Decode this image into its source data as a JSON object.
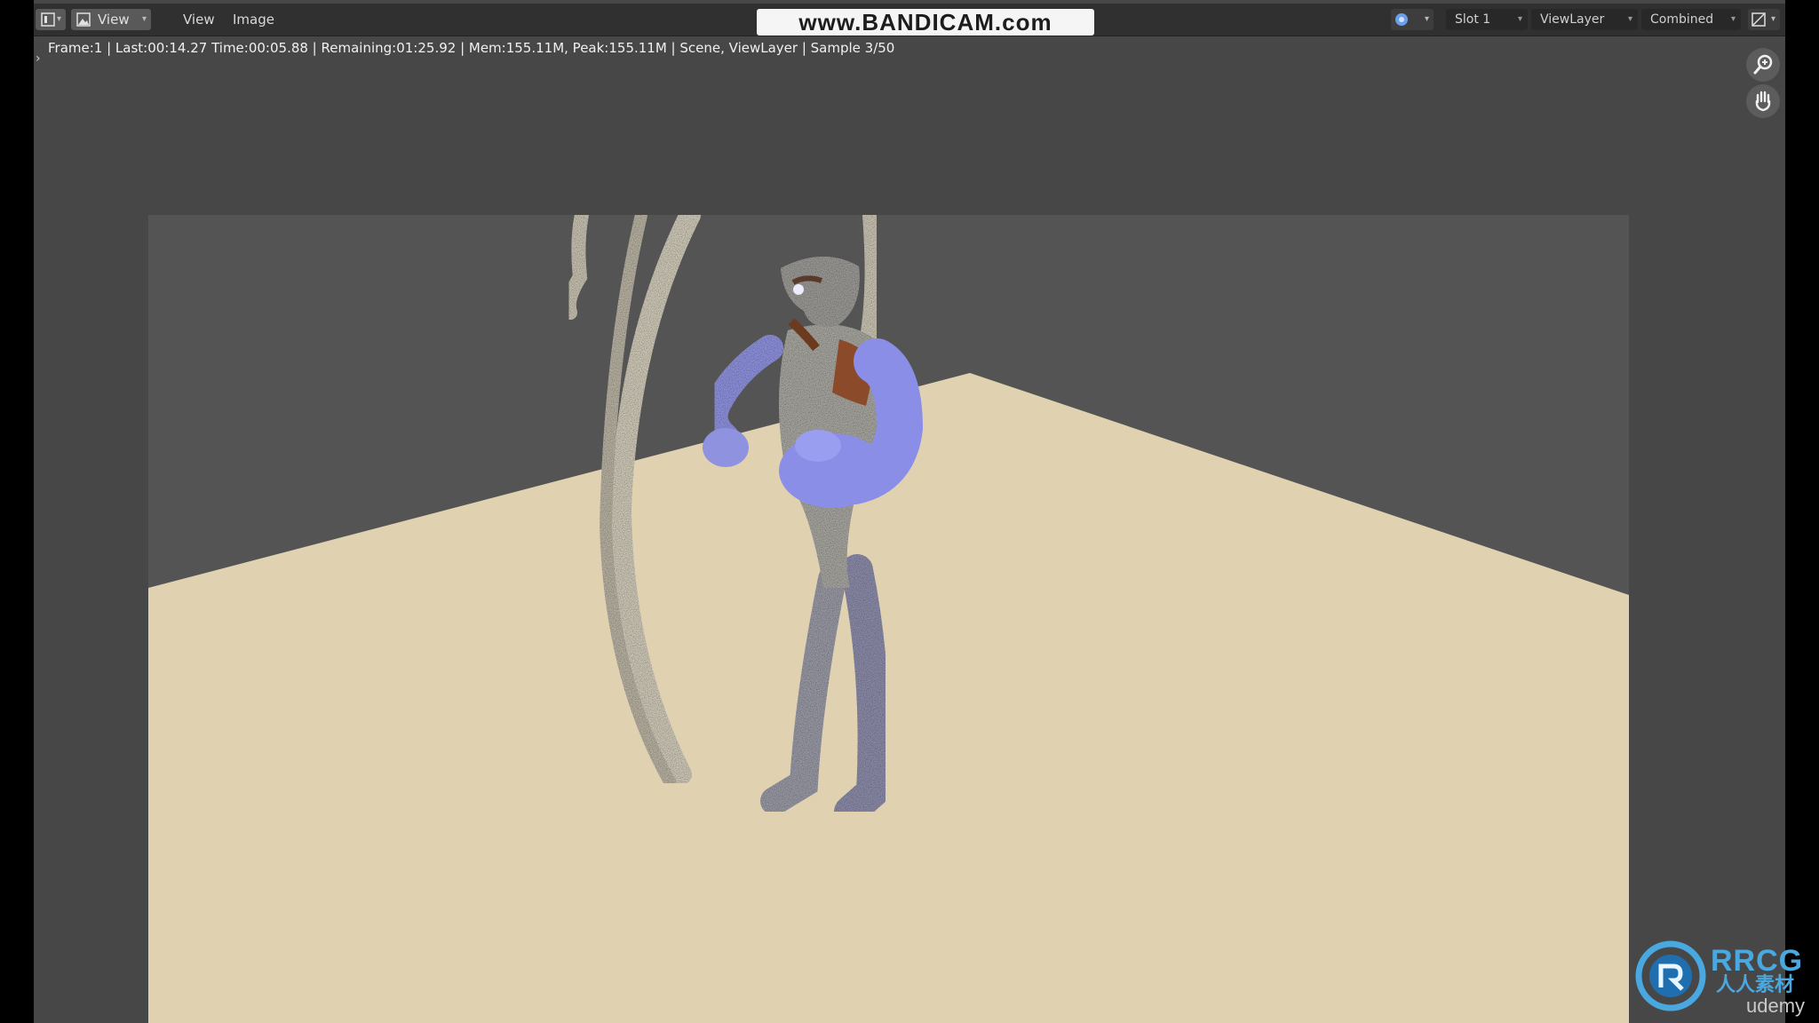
{
  "header": {
    "editor_type_icon": "image-editor-icon",
    "view_dropdown_label": "View",
    "menus": [
      "View",
      "Image"
    ],
    "watermark": "www.BANDICAM.com",
    "slot": "Slot 1",
    "view_layer": "ViewLayer",
    "pass": "Combined"
  },
  "status": {
    "text": "Frame:1 | Last:00:14.27 Time:00:05.88 | Remaining:01:25.92 | Mem:155.11M, Peak:155.11M | Scene, ViewLayer | Sample 3/50"
  },
  "corner_watermark": {
    "brand": "RRCG",
    "sub": "人人素材",
    "platform": "udemy"
  },
  "colors": {
    "header_bg": "#303030",
    "editor_bg": "#474747",
    "backdrop": "#545454",
    "floor": "#e0d2b0",
    "character_blue": "#8a8ee6",
    "strap_brown": "#8b4a2a"
  }
}
